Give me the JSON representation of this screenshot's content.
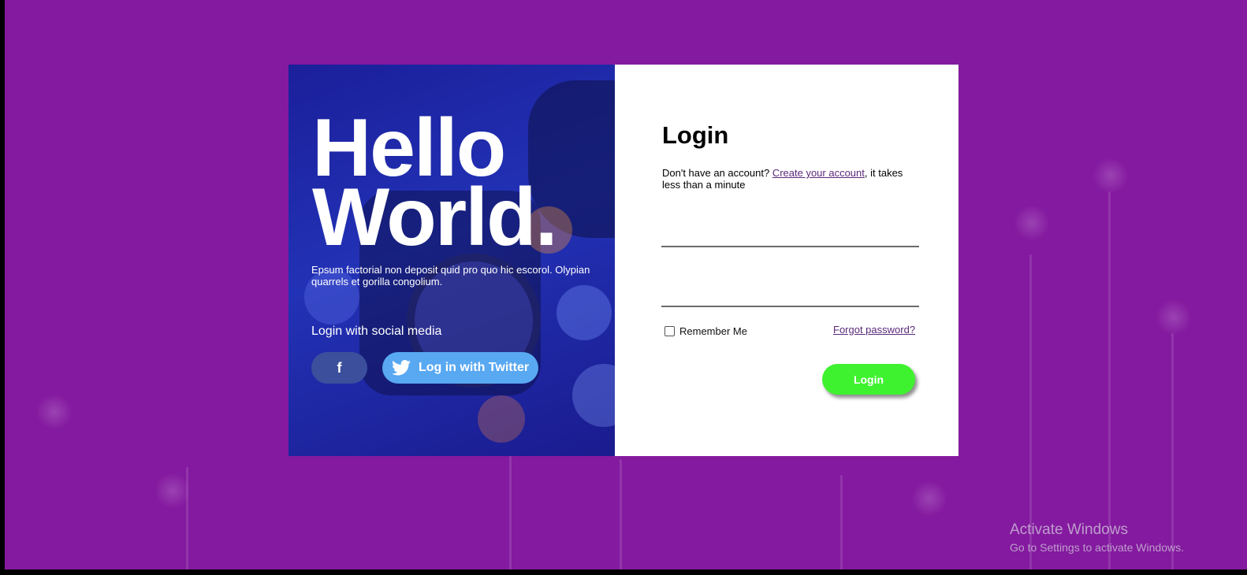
{
  "hero": {
    "title_line1": "Hello",
    "title_line2": "World.",
    "description": "Epsum factorial non deposit quid pro quo hic escorol. Olypian quarrels et gorilla congolium.",
    "social_label": "Login with social media",
    "facebook_label": "f",
    "twitter_label": "Log in with Twitter"
  },
  "form": {
    "title": "Login",
    "signup_prefix": "Don't have an account? ",
    "signup_link": "Create your account",
    "signup_suffix": ", it takes less than a minute",
    "username_value": "",
    "password_value": "",
    "remember_label": "Remember Me",
    "remember_checked": false,
    "forgot_label": "Forgot password?",
    "login_label": "Login"
  },
  "watermark": {
    "title": "Activate Windows",
    "subtitle": "Go to Settings to activate Windows."
  },
  "colors": {
    "page_background": "#841a9f",
    "hero_overlay": "#1b1f9a",
    "facebook": "#3b4f9c",
    "twitter": "#58a8f2",
    "login_button": "#3ff22f",
    "link": "#5b2a7a"
  },
  "icons": {
    "twitter": "twitter-bird-icon",
    "facebook": "facebook-f-icon"
  }
}
